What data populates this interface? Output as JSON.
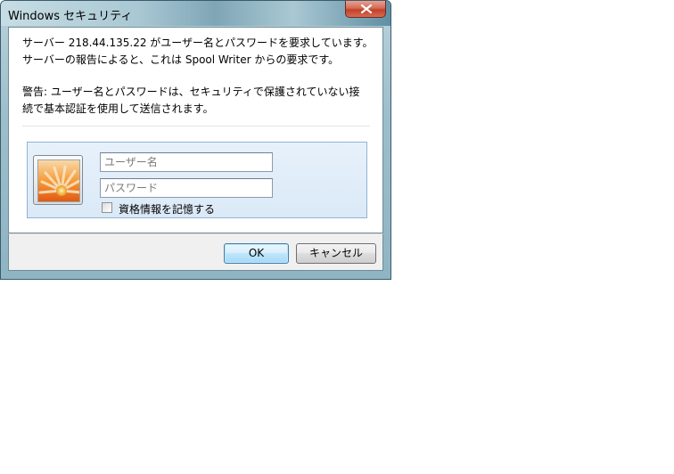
{
  "window": {
    "title": "Windows セキュリティ",
    "close_icon": "close-icon"
  },
  "message": {
    "line1": "サーバー 218.44.135.22 がユーザー名とパスワードを要求しています。",
    "line2": "サーバーの報告によると、これは Spool Writer からの要求です。",
    "warning_line1": "警告: ユーザー名とパスワードは、セキュリティで保護されていない接",
    "warning_line2": "続で基本認証を使用して送信されます。"
  },
  "credentials": {
    "username_placeholder": "ユーザー名",
    "username_value": "",
    "password_placeholder": "パスワード",
    "password_value": "",
    "remember_label": "資格情報を記憶する",
    "remember_checked": false,
    "user_tile_icon": "flower-user-picture-icon"
  },
  "buttons": {
    "ok": "OK",
    "cancel": "キャンセル"
  },
  "colors": {
    "title_bar": "#a9c8d3",
    "close_button": "#c0402a",
    "panel_border": "#8fb4d4",
    "panel_background": "#e7f1fb",
    "footer_background": "#f0f0f0",
    "ok_button_border": "#3c7fb1"
  }
}
